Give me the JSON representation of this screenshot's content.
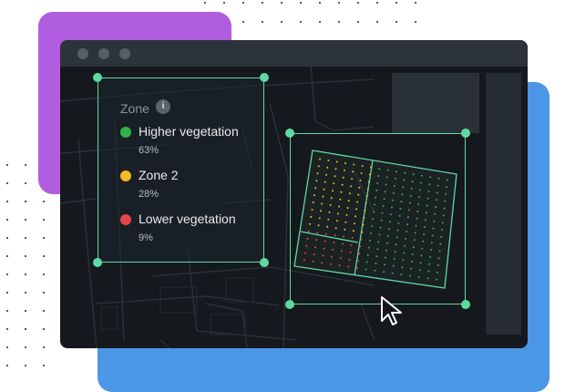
{
  "window": {
    "controls": [
      "close-dot",
      "minimize-dot",
      "maximize-dot"
    ]
  },
  "legend": {
    "title": "Zone",
    "info_icon": "i",
    "items": [
      {
        "label": "Higher vegetation",
        "percent": "63%",
        "color": "#2fb24a"
      },
      {
        "label": "Zone 2",
        "percent": "28%",
        "color": "#f5b921"
      },
      {
        "label": "Lower vegetation",
        "percent": "9%",
        "color": "#e5444a"
      }
    ]
  },
  "colors": {
    "accent": "#5fd9a2",
    "window_bg": "#15181d",
    "titlebar": "#2d333c",
    "purple_shape": "#b15ddf",
    "blue_shape": "#4c96e6"
  },
  "icons": {
    "cursor": "arrow-cursor-icon",
    "info": "info-icon"
  }
}
